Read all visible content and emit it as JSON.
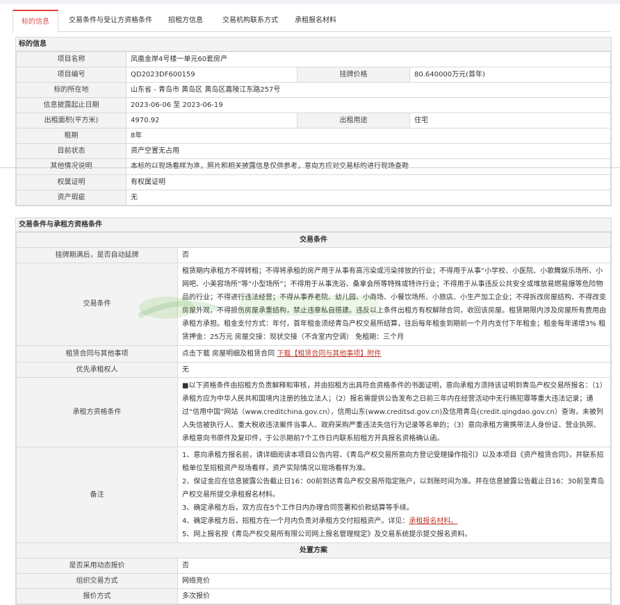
{
  "tabs": [
    {
      "label": "标的信息",
      "active": true
    },
    {
      "label": "交易条件与受让方资格条件",
      "active": false
    },
    {
      "label": "招租方信息",
      "active": false
    },
    {
      "label": "交易机构联系方式",
      "active": false
    },
    {
      "label": "承租报名材料",
      "active": false
    }
  ],
  "info": {
    "header": "标的信息",
    "name_label": "项目名称",
    "name": "凤凰金岸4号楼一单元60套房产",
    "code_label": "项目编号",
    "code": "QD2023DF600159",
    "price_label": "挂牌价格",
    "price": "80.640000万元(首年)",
    "location_label": "标的所在地",
    "location": "山东省 - 青岛市 黄岛区 黄岛区嘉陵江东路257号",
    "period_label": "信息披露起止日期",
    "period": "2023-06-06 至 2023-06-19",
    "area_label": "出租面积(平方米)",
    "area": "4970.92",
    "use_label": "出租用途",
    "use": "住宅",
    "term_label": "租期",
    "term": "8年",
    "status_label": "目前状态",
    "status": "资产空置无占用",
    "other_label": "其他情况说明",
    "other": "本标的以现场看样为准，照片和相关披露信息仅供参考，意向方应对交易标的进行现场查勘",
    "right_label": "权属证明",
    "right": "有权属证明",
    "defect_label": "资产瑕疵",
    "defect": "无"
  },
  "cond": {
    "header": "交易条件与承租方资格条件",
    "sub1": "交易条件",
    "extend_label": "挂牌期满后，是否自动延牌",
    "extend": "否",
    "trade_label": "交易条件",
    "trade": "租赁期内承租方不得转租；不得将承租的房产用于从事有高污染或污染排放的行业；不得用于从事“小学校、小医院、小歌舞娱乐场所、小网吧、小美容场所”等“小型场所”；不得用于从事洗浴、桑拿会所等特殊或特许行业；不得用于从事违反公共安全或堆放易燃易爆等危险物品的行业；不得进行违法经营；不得从事养老院、幼儿园、小商场、小餐饮场所、小旅店、小生产加工企业；不得拆改房屋结构、不得改变房屋外观，不得损伤房屋承重结构，禁止违章私自搭建。违反以上条件出租方有权解除合同，收回该房屋。租赁期限内涉及房屋所有费用由承租方承担。租金支付方式：年付，首年租金须经青岛产权交易所结算，往后每年租金到期前一个月内支付下年租金；租金每年递增3% 租赁押金：25万元 房屋交接：现状交接（不含室内空调） 免租期：三个月",
    "contract_label": "租赁合同与其他事项",
    "contract_text": "点击下载 房屋明细及租赁合同",
    "contract_link": "下载【租赁合同与其他事项】附件",
    "prior_label": "优先承租权人",
    "prior": "无",
    "qual_label": "承租方资格条件",
    "qual": "■以下资格条件由招租方负责解释和审核，并由招租方出具符合资格条件的书面证明，意向承租方须持该证明到青岛产权交易所报名：（1）承租方应为中华人民共和国境内注册的独立法人；（2）报名需提供公告发布之日前三年内在经营活动中无行贿犯罪等重大违法记录；通过“信用中国”网站（www.creditchina.gov.cn），信用山东(www.creditsd.gov.cn)及信用青岛(credit.qingdao.gov.cn）查询，未被列入失信被执行人、重大税收违法案件当事人、政府采购严重违法失信行为记录等名单的；（3）意向承租方需携带法人身份证、营业执照、承租意向书原件及复印件，于公示期前7个工作日内联系招租方开具报名资格确认函。",
    "note_label": "备注",
    "note1": "1、意向承租方报名前，请详细阅读本项目公告内容、《青岛产权交易所意向方登记受理操作指引》以及本项目《资产租赁合同》，并联系招租单位至招租资产现场看样，资产实际情况以现场看样为准。",
    "note2": "2、保证金应在信息披露公告截止日16：00前到达青岛产权交易所指定账户，以到账时间为准。并在信息披露公告截止日16：30前至青岛产权交易所提交承租报名材料。",
    "note3": "3、确定承租方后，双方应在5个工作日内办理合同签署和价款结算等手续。",
    "note4_text": "4、确定承租方后，招租方在一个月内负责对承租方交付招租资产。详见：",
    "note4_link": "承租报名材料。",
    "note5": "5、网上报名按《青岛产权交易所有限公司网上报名管理规定》及交易系统提示提交报名资料。",
    "sub2": "处置方案",
    "dynamic_label": "是否采用动态报价",
    "dynamic": "否",
    "org_label": "组织交易方式",
    "org": "网络竞价",
    "quote_label": "报价方式",
    "quote": "多次报价"
  },
  "colors": {
    "accent": "#e0403a",
    "link": "#c0392b",
    "header_bg": "#f3f3f3",
    "border": "#d9d9d9"
  }
}
